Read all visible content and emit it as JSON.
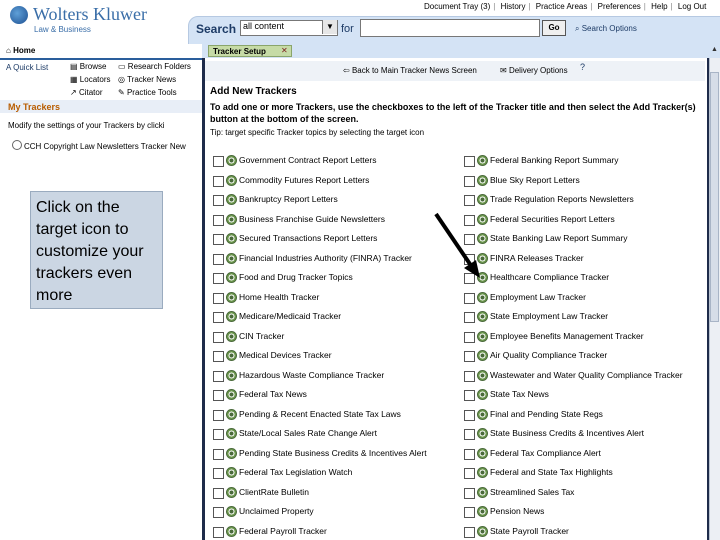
{
  "header": {
    "brand_name": "Wolters Kluwer",
    "brand_sub": "Law & Business",
    "topnav": [
      "Document Tray (3)",
      "History",
      "Practice Areas",
      "Preferences",
      "Help",
      "Log Out"
    ],
    "search_label": "Search",
    "content_select_value": "all content",
    "for_label": "for",
    "go_label": "Go",
    "search_options": "Search Options"
  },
  "left": {
    "home_tab": "Home",
    "quicklist": "A Quick List",
    "links": [
      "Browse",
      "Research Folders",
      "Locators",
      "Tracker News",
      "Citator",
      "Practice Tools"
    ],
    "mytrackers_title": "My Trackers",
    "modify_text": "Modify the settings of your Trackers by clicki",
    "tracker_row": "CCH Copyright Law Newsletters Tracker New"
  },
  "callout": {
    "text": "Click on the target icon to customize your trackers even more"
  },
  "panel": {
    "tab_label": "Tracker Setup",
    "back_link": "Back to Main Tracker News Screen",
    "delivery_link": "Delivery Options",
    "help": "?",
    "title": "Add New Trackers",
    "instructions": "To add one or more Trackers, use the checkboxes to the left of the Tracker title and then select the Add Tracker(s) button at the bottom of the screen.",
    "tip": "Tip: target specific Tracker topics by selecting the target icon",
    "left_column": [
      "Government Contract Report Letters",
      "Commodity Futures Report Letters",
      "Bankruptcy Report Letters",
      "Business Franchise Guide Newsletters",
      "Secured Transactions Report Letters",
      "Financial Industries Authority (FINRA) Tracker",
      "Food and Drug Tracker Topics",
      "Home Health Tracker",
      "Medicare/Medicaid Tracker",
      "CIN Tracker",
      "Medical Devices Tracker",
      "Hazardous Waste Compliance Tracker",
      "Federal Tax News",
      "Pending & Recent Enacted State Tax Laws",
      "State/Local Sales Rate Change Alert",
      "Pending State Business Credits & Incentives Alert",
      "Federal Tax Legislation Watch",
      "ClientRate Bulletin",
      "Unclaimed Property",
      "Federal Payroll Tracker"
    ],
    "right_column": [
      "Federal Banking Report Summary",
      "Blue Sky Report Letters",
      "Trade Regulation Reports Newsletters",
      "Federal Securities Report Letters",
      "State Banking Law Report Summary",
      "FINRA Releases Tracker",
      "Healthcare Compliance Tracker",
      "Employment Law Tracker",
      "State Employment Law Tracker",
      "Employee Benefits Management Tracker",
      "Air Quality Compliance Tracker",
      "Wastewater and Water Quality Compliance Tracker",
      "State Tax News",
      "Final and Pending State Regs",
      "State Business Credits & Incentives Alert",
      "Federal Tax Compliance Alert",
      "Federal and State Tax Highlights",
      "Streamlined Sales Tax",
      "Pension News",
      "State Payroll Tracker"
    ]
  }
}
